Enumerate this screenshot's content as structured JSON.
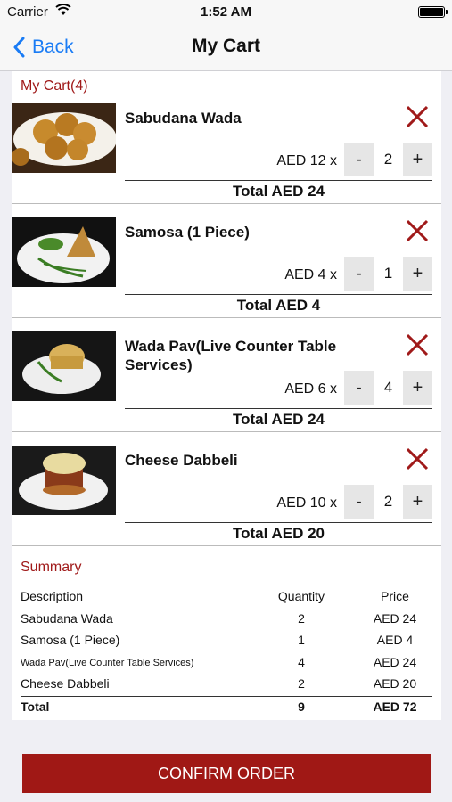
{
  "status_bar": {
    "carrier": "Carrier",
    "time": "1:52 AM"
  },
  "nav": {
    "back_label": "Back",
    "title": "My Cart"
  },
  "cart": {
    "heading": "My Cart(4)",
    "items": [
      {
        "name": "Sabudana Wada",
        "unit_price": "AED 12 x",
        "qty": "2",
        "total": "Total AED 24",
        "minus": "-",
        "plus": "+"
      },
      {
        "name": "Samosa (1 Piece)",
        "unit_price": "AED 4 x",
        "qty": "1",
        "total": "Total AED 4",
        "minus": "-",
        "plus": "+"
      },
      {
        "name": "Wada Pav(Live Counter Table Services)",
        "unit_price": "AED 6 x",
        "qty": "4",
        "total": "Total AED 24",
        "minus": "-",
        "plus": "+"
      },
      {
        "name": "Cheese Dabbeli",
        "unit_price": "AED 10 x",
        "qty": "2",
        "total": "Total AED 20",
        "minus": "-",
        "plus": "+"
      }
    ]
  },
  "summary": {
    "heading": "Summary",
    "columns": [
      "Description",
      "Quantity",
      "Price"
    ],
    "rows": [
      [
        "Sabudana Wada",
        "2",
        "AED 24"
      ],
      [
        "Samosa (1 Piece)",
        "1",
        "AED 4"
      ],
      [
        "Wada Pav(Live Counter Table Services)",
        "4",
        "AED 24"
      ],
      [
        "Cheese Dabbeli",
        "2",
        "AED 20"
      ]
    ],
    "total": [
      "Total",
      "9",
      "AED 72"
    ]
  },
  "confirm_label": "CONFIRM ORDER",
  "colors": {
    "accent": "#a01815",
    "link": "#1a7cf5"
  },
  "icons": {
    "back": "chevron-left-icon",
    "remove": "close-icon",
    "wifi": "wifi-icon",
    "battery": "battery-icon"
  }
}
